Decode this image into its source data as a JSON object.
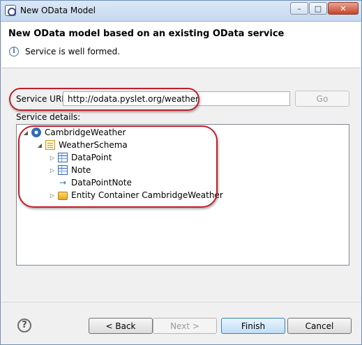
{
  "window": {
    "title": "New OData Model"
  },
  "header": {
    "title": "New OData model based on an existing OData service",
    "message": "Service is well formed."
  },
  "form": {
    "service_url_label": "Service URL:",
    "service_url_value": "http://odata.pyslet.org/weather",
    "go_label": "Go",
    "details_label": "Service details:"
  },
  "tree": [
    {
      "label": "CambridgeWeather",
      "icon": "service-icon",
      "expanded": true
    },
    {
      "label": "WeatherSchema",
      "icon": "schema-icon",
      "expanded": true
    },
    {
      "label": "DataPoint",
      "icon": "entity-type-icon",
      "expanded": false
    },
    {
      "label": "Note",
      "icon": "entity-type-icon",
      "expanded": false
    },
    {
      "label": "DataPointNote",
      "icon": "association-arrow-icon"
    },
    {
      "label": "Entity Container CambridgeWeather",
      "icon": "container-folder-icon",
      "expanded": false
    }
  ],
  "footer": {
    "back_label": "< Back",
    "next_label": "Next >",
    "finish_label": "Finish",
    "cancel_label": "Cancel"
  },
  "colors": {
    "annotation": "#c0202a",
    "accent": "#3c7fb1"
  }
}
